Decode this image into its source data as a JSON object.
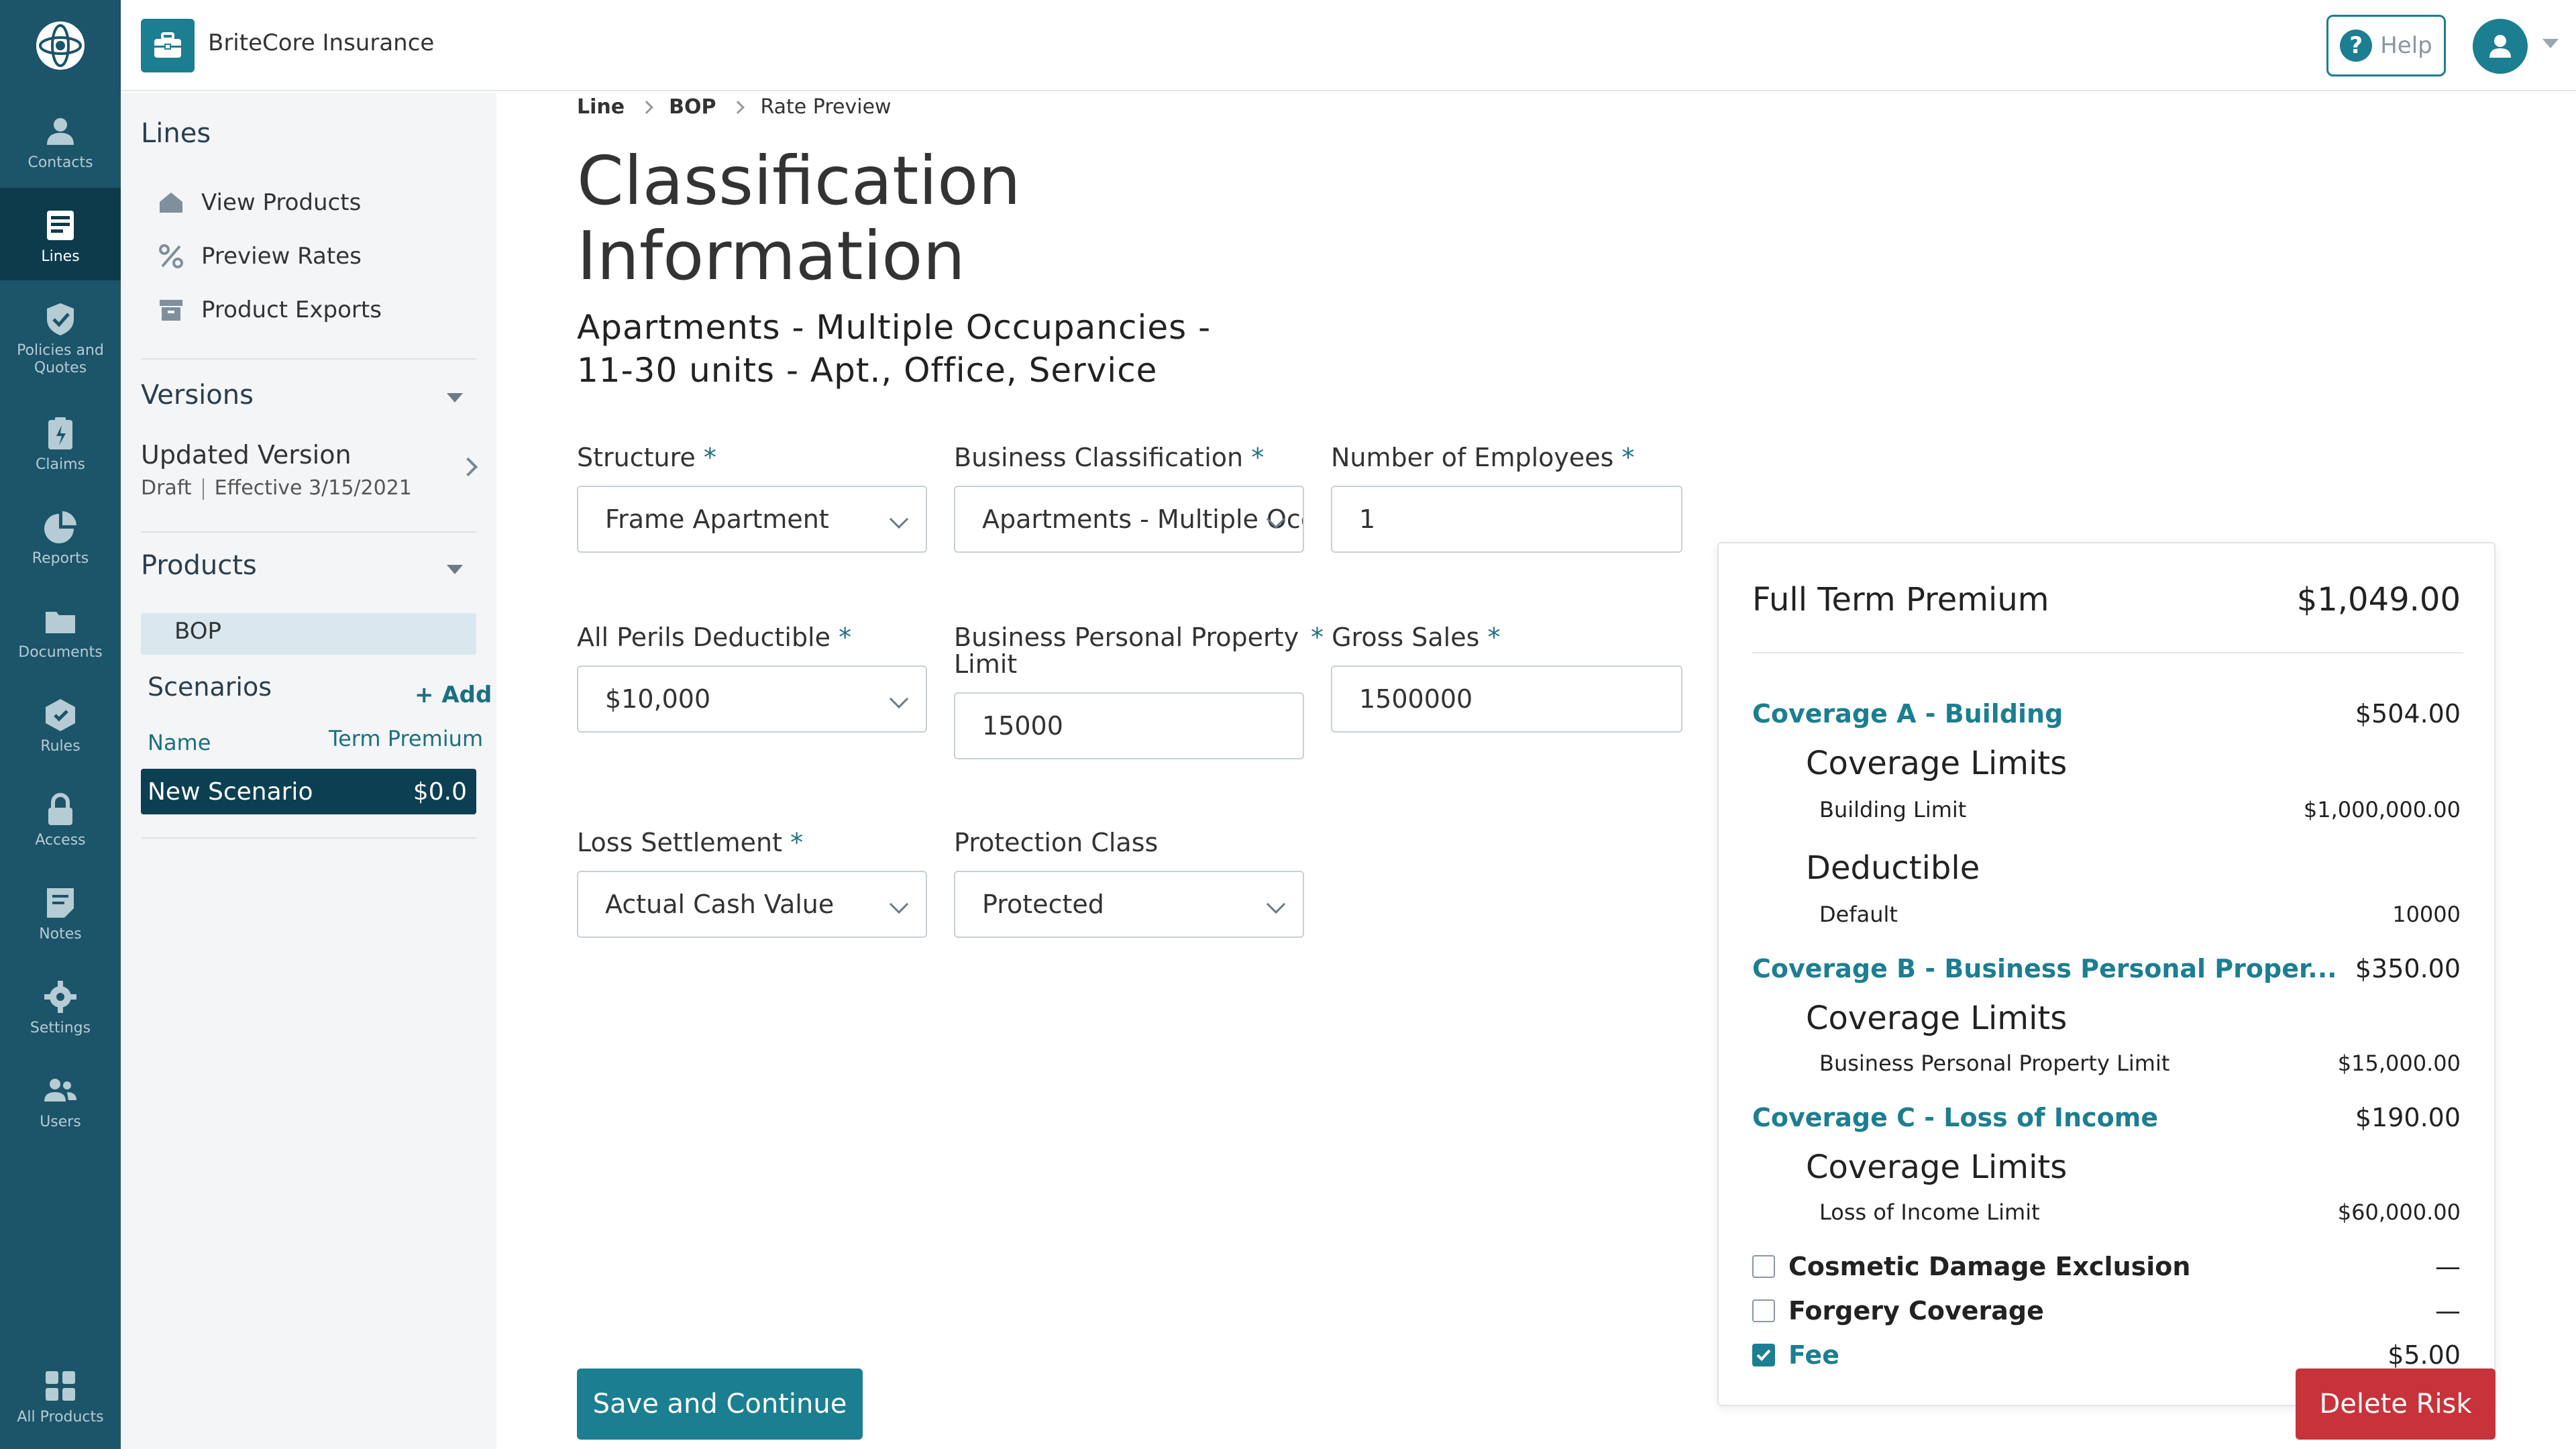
{
  "app": {
    "brand_name": "BriteCore Insurance",
    "help_label": "Help"
  },
  "sidebar": {
    "items": [
      {
        "label": "Contacts",
        "icon": "person-icon"
      },
      {
        "label": "Lines",
        "icon": "lines-icon",
        "active": true
      },
      {
        "label": "Policies and Quotes",
        "icon": "shield-icon"
      },
      {
        "label": "Claims",
        "icon": "claims-icon"
      },
      {
        "label": "Reports",
        "icon": "pie-chart-icon"
      },
      {
        "label": "Documents",
        "icon": "folder-icon"
      },
      {
        "label": "Rules",
        "icon": "rules-icon"
      },
      {
        "label": "Access",
        "icon": "lock-icon"
      },
      {
        "label": "Notes",
        "icon": "notes-icon"
      },
      {
        "label": "Settings",
        "icon": "gear-icon"
      },
      {
        "label": "Users",
        "icon": "users-icon"
      }
    ],
    "bottom": {
      "label": "All Products",
      "icon": "grid-icon"
    }
  },
  "subnav": {
    "lines_heading": "Lines",
    "links": [
      {
        "label": "View Products",
        "icon": "home-icon"
      },
      {
        "label": "Preview Rates",
        "icon": "percent-icon"
      },
      {
        "label": "Product Exports",
        "icon": "archive-icon"
      }
    ],
    "versions_heading": "Versions",
    "version": {
      "name": "Updated Version",
      "status": "Draft",
      "effective": "Effective 3/15/2021"
    },
    "products_heading": "Products",
    "product": "BOP",
    "scenarios_heading": "Scenarios",
    "add_label": "+ Add",
    "col_name": "Name",
    "col_premium": "Term Premium",
    "scenario": {
      "name": "New Scenario",
      "premium": "$0.0"
    }
  },
  "breadcrumb": {
    "items": [
      "Line",
      "BOP",
      "Rate Preview"
    ]
  },
  "page": {
    "title_line1": "Classification",
    "title_line2": "Information",
    "subtitle_line1": "Apartments - Multiple Occupancies -",
    "subtitle_line2": "11-30 units - Apt., Office, Service"
  },
  "form": {
    "structure": {
      "label": "Structure",
      "value": "Frame Apartment"
    },
    "business_classification": {
      "label": "Business Classification",
      "value": "Apartments - Multiple Occ"
    },
    "employees": {
      "label": "Number of Employees",
      "value": "1"
    },
    "deductible": {
      "label": "All Perils Deductible",
      "value": "$10,000"
    },
    "bpp_limit": {
      "label_line1": "Business Personal Property",
      "label_line2": "Limit",
      "value": "15000"
    },
    "gross_sales": {
      "label": "Gross Sales",
      "value": "1500000"
    },
    "loss_settlement": {
      "label": "Loss Settlement",
      "value": "Actual Cash Value"
    },
    "protection_class": {
      "label": "Protection Class",
      "value": "Protected"
    },
    "required_mark": "*"
  },
  "premium": {
    "title": "Full Term Premium",
    "total": "$1,049.00",
    "coverage_a": {
      "name": "Coverage A - Building",
      "amount": "$504.00",
      "limits_heading": "Coverage Limits",
      "limit_label": "Building Limit",
      "limit_value": "$1,000,000.00",
      "deductible_heading": "Deductible",
      "deductible_label": "Default",
      "deductible_value": "10000"
    },
    "coverage_b": {
      "name": "Coverage B - Business Personal Proper...",
      "amount": "$350.00",
      "limits_heading": "Coverage Limits",
      "limit_label": "Business Personal Property Limit",
      "limit_value": "$15,000.00"
    },
    "coverage_c": {
      "name": "Coverage C - Loss of Income",
      "amount": "$190.00",
      "limits_heading": "Coverage Limits",
      "limit_label": "Loss of Income Limit",
      "limit_value": "$60,000.00"
    },
    "options": [
      {
        "label": "Cosmetic Damage Exclusion",
        "value": "—",
        "checked": false
      },
      {
        "label": "Forgery Coverage",
        "value": "—",
        "checked": false
      },
      {
        "label": "Fee",
        "value": "$5.00",
        "checked": true
      }
    ]
  },
  "actions": {
    "save": "Save and Continue",
    "delete": "Delete Risk"
  },
  "colors": {
    "sidebar": "#1c5469",
    "sidebar_active": "#0e3b4b",
    "accent": "#1c7e91",
    "danger": "#c8323a",
    "scenario_row": "#0d3f52"
  }
}
